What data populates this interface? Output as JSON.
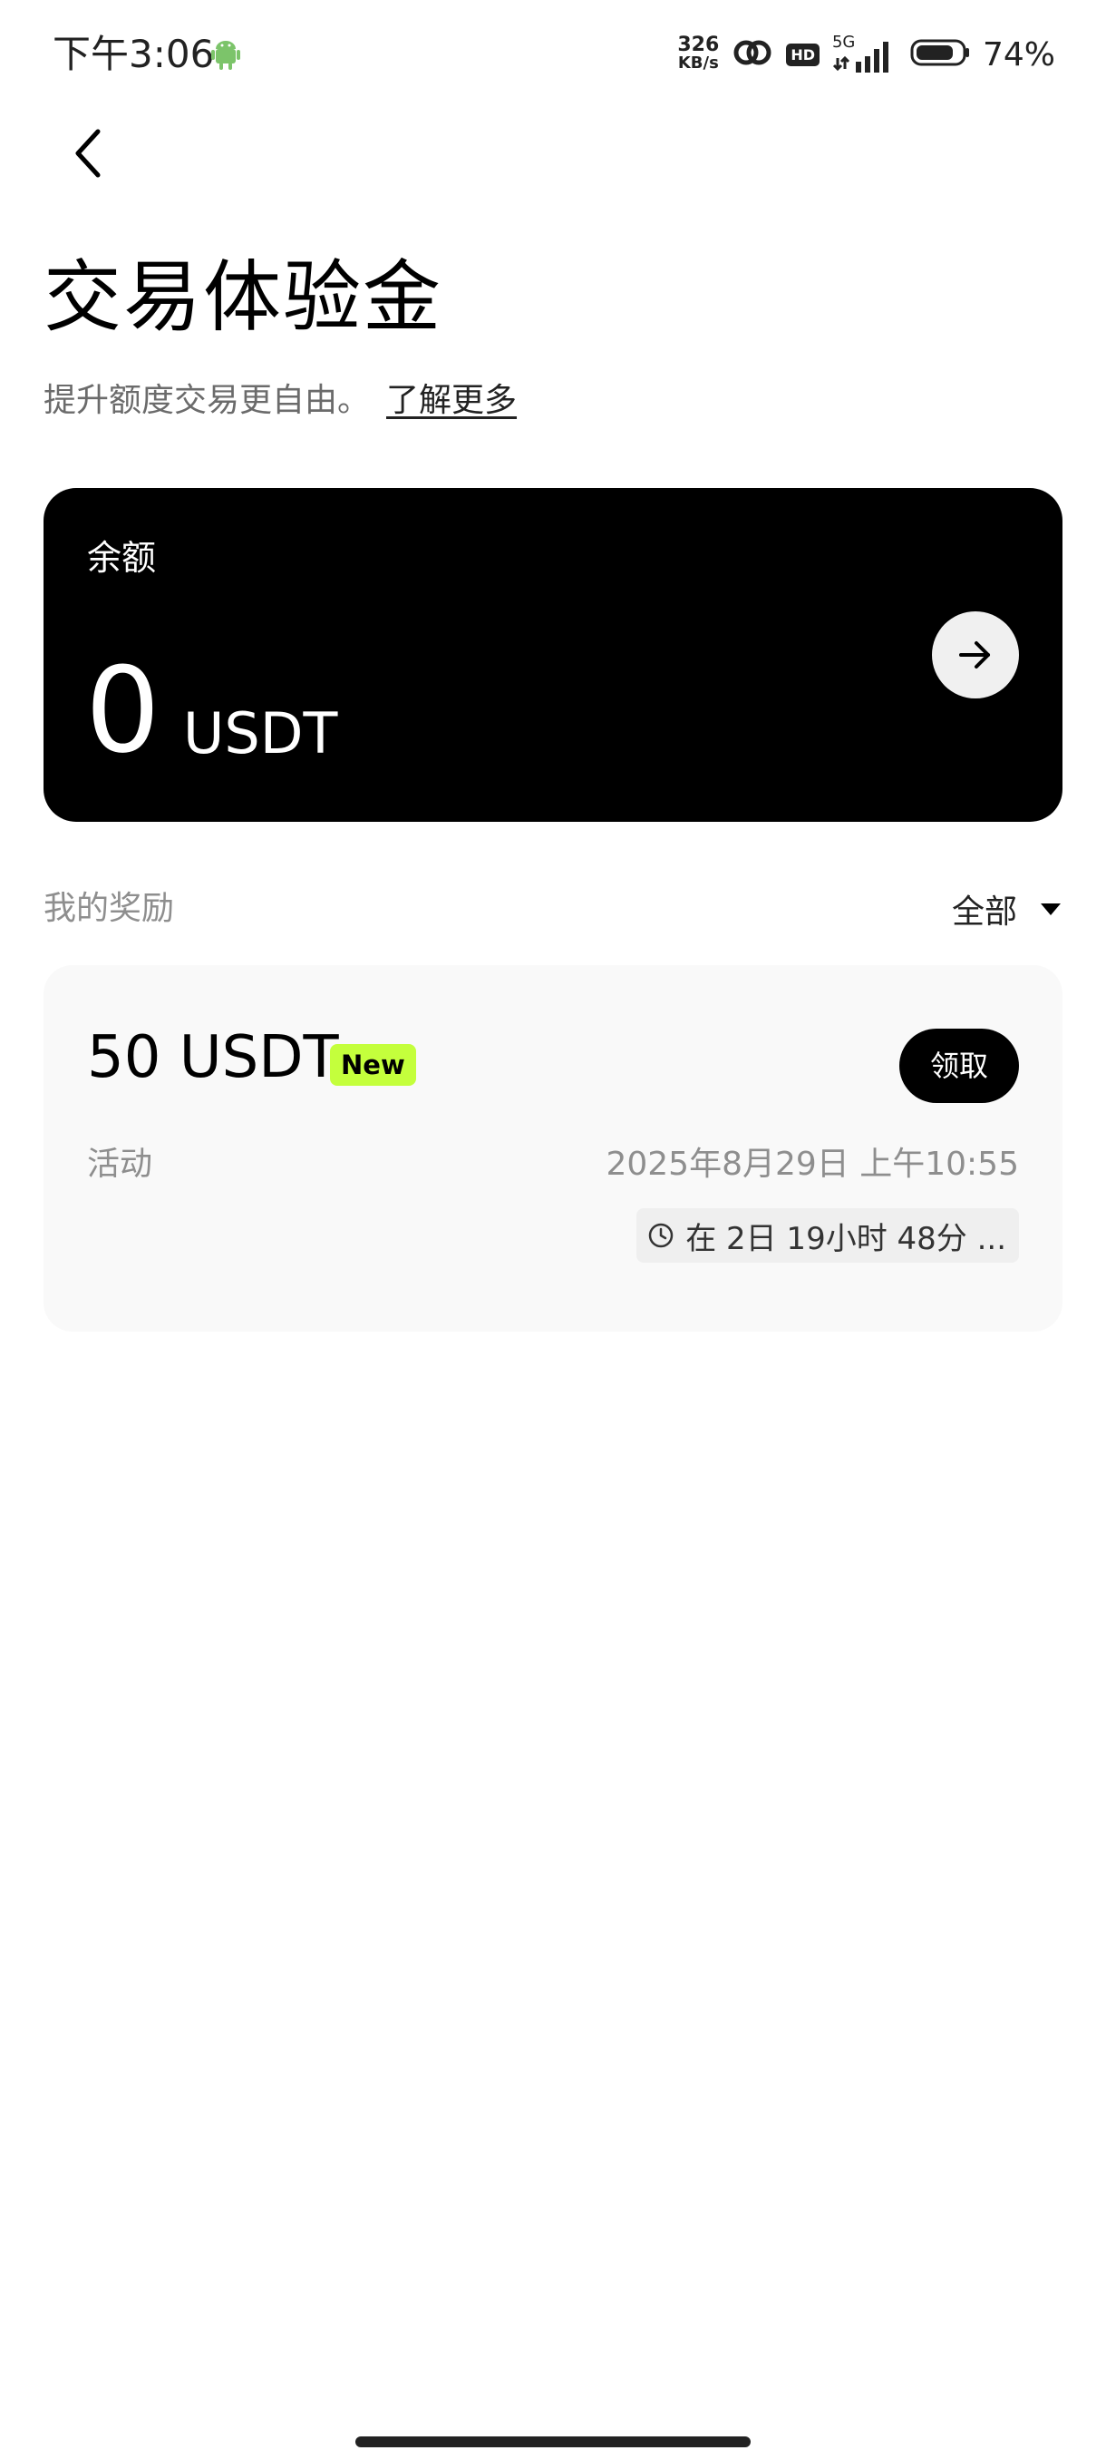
{
  "status_bar": {
    "time": "下午3:06",
    "net_speed_value": "326",
    "net_speed_unit": "KB/s",
    "hd_label": "HD",
    "network_type": "5G",
    "battery": "74%"
  },
  "header": {
    "title": "交易体验金",
    "subtitle": "提升额度交易更自由。",
    "learn_more": "了解更多"
  },
  "balance": {
    "label": "余额",
    "amount": "0",
    "unit": "USDT"
  },
  "rewards": {
    "section_label": "我的奖励",
    "filter_label": "全部",
    "items": [
      {
        "amount": "50 USDT",
        "badge": "New",
        "claim_label": "领取",
        "type": "活动",
        "date": "2025年8月29日 上午10:55",
        "countdown": "在 2日 19小时 48分 ..."
      }
    ]
  },
  "colors": {
    "accent_badge": "#c4ff3c",
    "card_dark": "#000000",
    "card_light": "#f9f9f9"
  }
}
